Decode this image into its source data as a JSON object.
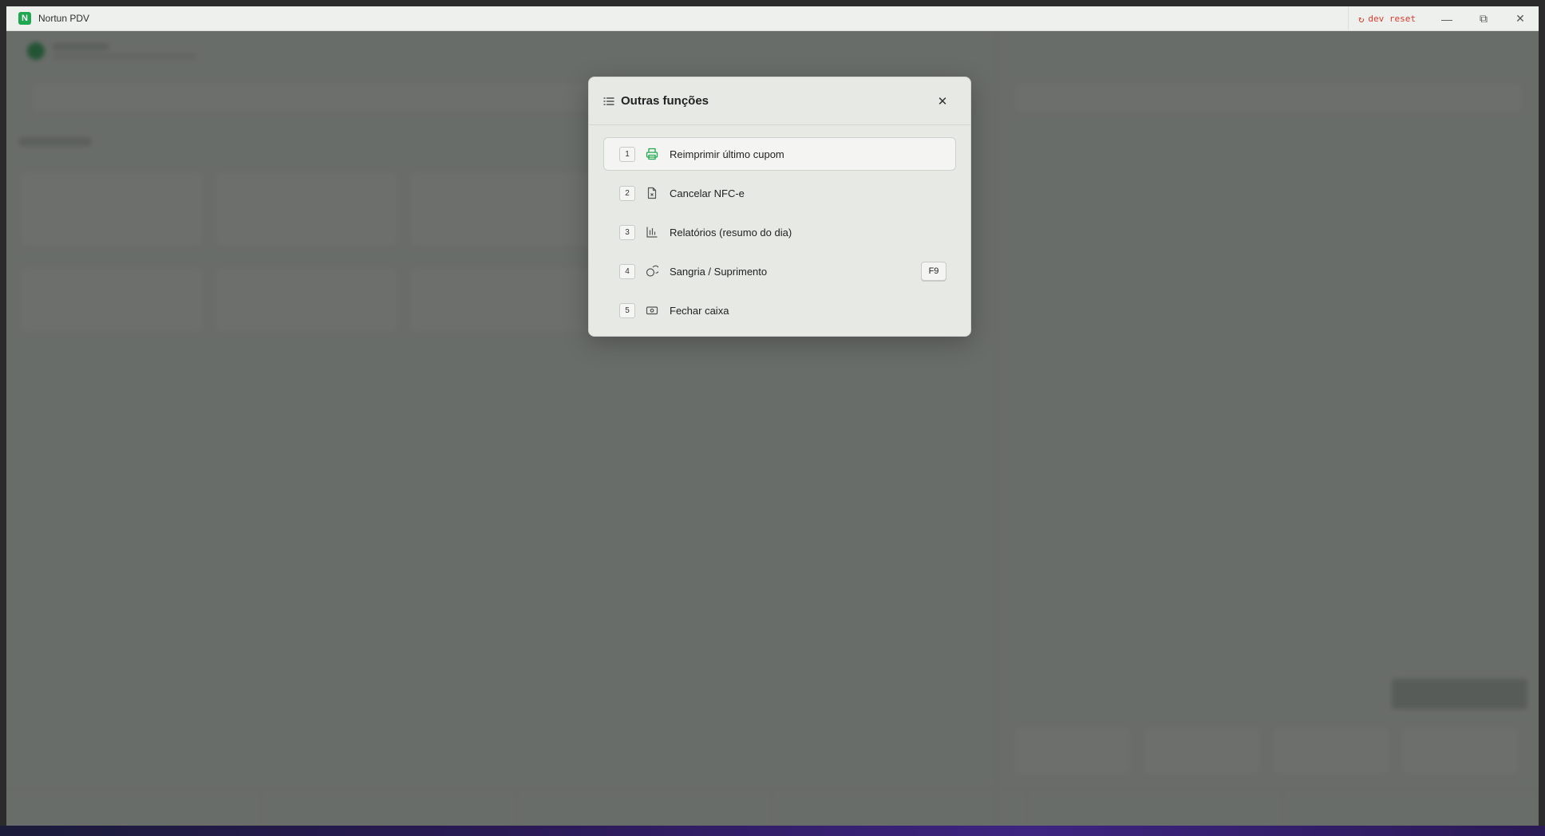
{
  "titlebar": {
    "app_icon": "N",
    "title": "Nortun PDV",
    "dev_reset": "dev reset",
    "minimize_icon": "—",
    "restore_icon": "⧉",
    "close_icon": "✕"
  },
  "modal": {
    "title": "Outras funções",
    "close_icon": "✕",
    "items": [
      {
        "key": "1",
        "icon": "printer-icon",
        "label": "Reimprimir último cupom",
        "active": true
      },
      {
        "key": "2",
        "icon": "file-x-icon",
        "label": "Cancelar NFC-e"
      },
      {
        "key": "3",
        "icon": "bar-chart-icon",
        "label": "Relatórios (resumo do dia)"
      },
      {
        "key": "4",
        "icon": "coins-icon",
        "label": "Sangria / Suprimento",
        "shortcut": "F9"
      },
      {
        "key": "5",
        "icon": "banknote-icon",
        "label": "Fechar caixa"
      }
    ]
  },
  "colors": {
    "accent_green": "#1fa84f",
    "dev_reset_red": "#d93a2b",
    "overlay": "rgba(40,44,42,0.68)"
  }
}
